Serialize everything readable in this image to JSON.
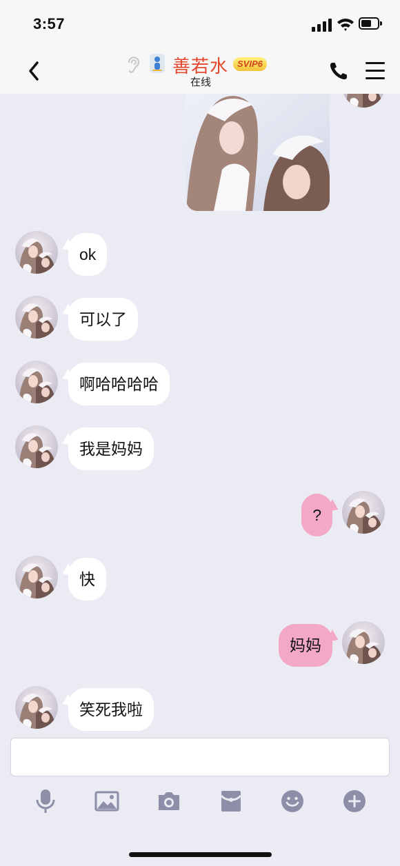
{
  "status_bar": {
    "time": "3:57"
  },
  "header": {
    "contact_name": "善若水",
    "vip_badge": "SVIP6",
    "online_status": "在线"
  },
  "messages": [
    {
      "side": "in",
      "text": "ok"
    },
    {
      "side": "in",
      "text": "可以了"
    },
    {
      "side": "in",
      "text": "啊哈哈哈哈"
    },
    {
      "side": "in",
      "text": "我是妈妈"
    },
    {
      "side": "out",
      "text": "?"
    },
    {
      "side": "in",
      "text": "快"
    },
    {
      "side": "out",
      "text": "妈妈"
    },
    {
      "side": "in",
      "text": "笑死我啦"
    }
  ],
  "input": {
    "placeholder": ""
  },
  "toolbar": {
    "icons": [
      "microphone-icon",
      "image-icon",
      "camera-icon",
      "red-packet-icon",
      "emoji-icon",
      "plus-icon"
    ]
  },
  "colors": {
    "accent_name": "#e4482c",
    "outgoing_bubble": "#f2a8c6",
    "incoming_bubble": "#ffffff",
    "chat_background": "#ebebf4",
    "toolbar_icon": "#8e8ea8"
  }
}
